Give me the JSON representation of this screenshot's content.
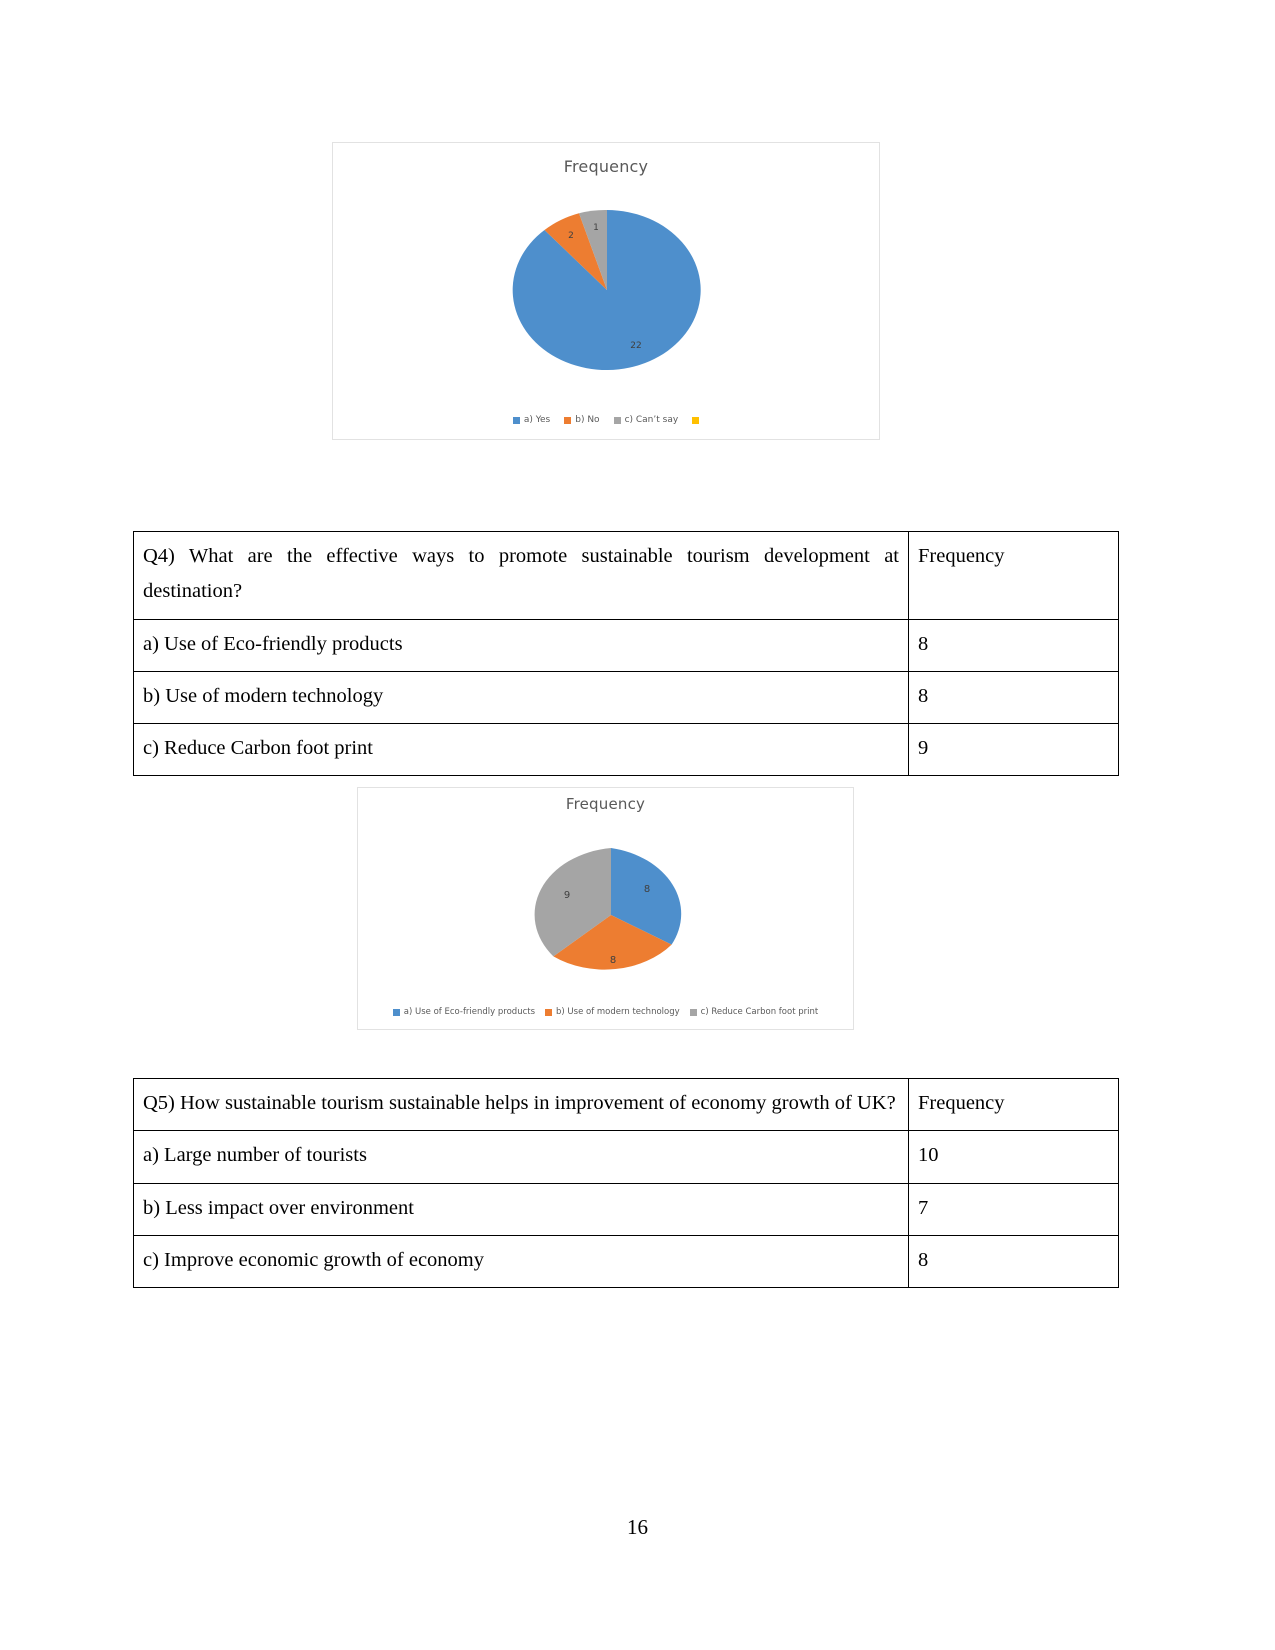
{
  "document": {
    "page_number": "16"
  },
  "charts": [
    {
      "id": "chart-q3-frequency",
      "title": "Frequency",
      "legend": [
        {
          "label": "a) Yes",
          "color": "#4e8fcc"
        },
        {
          "label": "b) No",
          "color": "#ed7d31"
        },
        {
          "label": "c) Can’t say",
          "color": "#a5a5a5"
        },
        {
          "label": "",
          "color": "#ffc000"
        }
      ]
    },
    {
      "id": "chart-q4-frequency",
      "title": "Frequency",
      "legend": [
        {
          "label": "a) Use of Eco-friendly products",
          "color": "#4e8fcc"
        },
        {
          "label": "b) Use of modern technology",
          "color": "#ed7d31"
        },
        {
          "label": "c) Reduce Carbon foot print",
          "color": "#a5a5a5"
        }
      ]
    }
  ],
  "chart_data": [
    {
      "type": "pie",
      "title": "Frequency",
      "labels": [
        "a) Yes",
        "b) No",
        "c) Can’t say"
      ],
      "values": [
        22,
        2,
        1
      ],
      "data_labels": [
        "22",
        "2",
        "1"
      ],
      "colors": [
        "#4e8fcc",
        "#ed7d31",
        "#a5a5a5"
      ],
      "legend_position": "bottom",
      "legend_entries": [
        "a) Yes",
        "b) No",
        "c) Can’t say",
        ""
      ],
      "start_angle_deg": 0,
      "total": 25
    },
    {
      "type": "pie",
      "title": "Frequency",
      "labels": [
        "a) Use of Eco-friendly products",
        "b) Use of modern technology",
        "c) Reduce Carbon foot print"
      ],
      "values": [
        8,
        8,
        9
      ],
      "data_labels": [
        "8",
        "8",
        "9"
      ],
      "colors": [
        "#4e8fcc",
        "#ed7d31",
        "#a5a5a5"
      ],
      "legend_position": "bottom",
      "legend_entries": [
        "a) Use of Eco-friendly products",
        "b) Use of modern technology",
        "c) Reduce Carbon foot print"
      ],
      "start_angle_deg": 0,
      "total": 25
    }
  ],
  "tables": [
    {
      "id": "q4",
      "question": "Q4)  What  are  the  effective  ways  to  promote  sustainable  tourism development at destination?",
      "frequency_header": "Frequency",
      "rows": [
        {
          "option": "a) Use of Eco-friendly products",
          "frequency": "8"
        },
        {
          "option": "b) Use of modern technology",
          "frequency": "8"
        },
        {
          "option": "c) Reduce Carbon foot print",
          "frequency": "9"
        }
      ]
    },
    {
      "id": "q5",
      "question": "Q5) How sustainable tourism sustainable helps in improvement of economy growth of UK?",
      "frequency_header": "Frequency",
      "rows": [
        {
          "option": "a) Large number of tourists",
          "frequency": "10"
        },
        {
          "option": "b) Less impact over environment",
          "frequency": "7"
        },
        {
          "option": "c) Improve economic growth of economy",
          "frequency": "8"
        }
      ]
    }
  ]
}
